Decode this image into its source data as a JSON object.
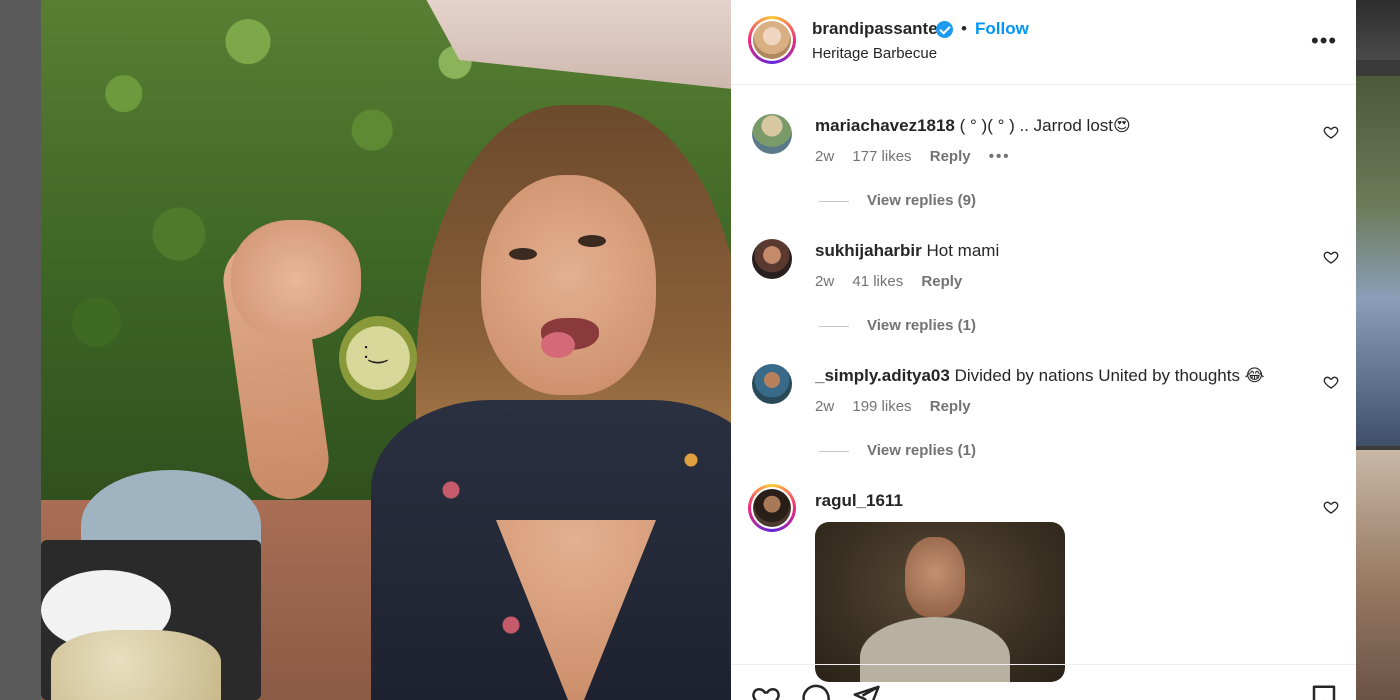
{
  "post": {
    "username": "brandipassante",
    "verified": true,
    "separator": "•",
    "follow_label": "Follow",
    "location": "Heritage Barbecue",
    "more_icon": "more-options-icon"
  },
  "comments": [
    {
      "username": "mariachavez1818",
      "text": "( ° )( ° ) .. Jarrod lost😍",
      "age": "2w",
      "likes": "177 likes",
      "reply_label": "Reply",
      "has_more": true,
      "more_label": "•••",
      "view_replies": "View replies (9)"
    },
    {
      "username": "sukhijaharbir",
      "text": "Hot mami",
      "age": "2w",
      "likes": "41 likes",
      "reply_label": "Reply",
      "view_replies": "View replies (1)"
    },
    {
      "username": "_simply.aditya03",
      "text": "Divided by nations United by thoughts 😂",
      "age": "2w",
      "likes": "199 likes",
      "reply_label": "Reply",
      "view_replies": "View replies (1)"
    },
    {
      "username": "ragul_1611",
      "text": "",
      "attachment": "gif"
    }
  ],
  "actions": {
    "like_icon": "heart-icon",
    "comment_icon": "comment-icon",
    "share_icon": "share-icon",
    "save_icon": "bookmark-icon"
  },
  "colors": {
    "accent": "#0095f6",
    "verified": "#1d9bf0",
    "text": "#262626",
    "muted": "#737373"
  }
}
